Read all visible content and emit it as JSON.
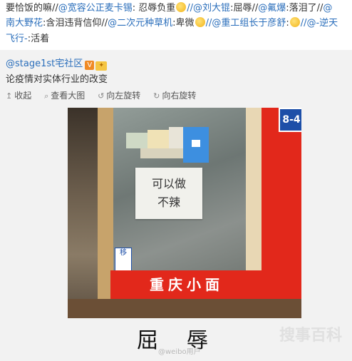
{
  "repost": {
    "line1_text": "要恰饭的嘛//",
    "line1_user1": "@宽容公正麦卡锡",
    "line1_text2": ": 忍辱负重",
    "line1_user2": "//@刘大锟",
    "line1_text3": ":屈辱//",
    "line1_user3": "@氟爆",
    "line1_text4": ":落泪了//",
    "line1_user4": "@",
    "line2_user1": "南大野花",
    "line2_text1": ":含泪违背信仰//",
    "line2_user2": "@二次元种草机",
    "line2_text2": ":卑微",
    "line2_user3": "//@重工组长于彦舒",
    "line2_text3": ":",
    "line2_user4": "//@-逆天",
    "line3_user1": "飞行-",
    "line3_text1": ":活着"
  },
  "original": {
    "author": "@stage1st宅社区",
    "verified_badge": "V",
    "crown_badge": "✦",
    "description": "论疫情对实体行业的改变",
    "toolbar": {
      "collect": "收起",
      "view_large": "查看大图",
      "rotate_left": "向左旋转",
      "rotate_right": "向右旋转"
    },
    "photo": {
      "plaque": "8-4",
      "sign_paper_line1": "可以做",
      "sign_paper_line2": "不辣",
      "sticker": "移",
      "red_sign": "重庆小面"
    },
    "caption": "屈辱",
    "watermark_small": "@weibo用户",
    "watermark_large": "搜事百科"
  },
  "colors": {
    "link": "#2a6ebb",
    "shop_red": "#e2281b",
    "plaque_blue": "#1d4fa8"
  }
}
